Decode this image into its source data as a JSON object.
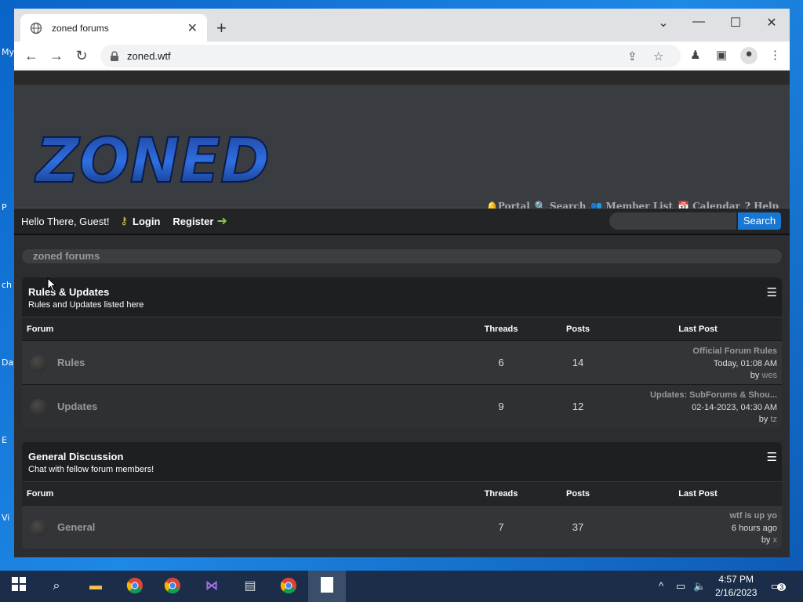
{
  "browser": {
    "tab_title": "zoned forums",
    "url": "zoned.wtf",
    "icons": [
      "globe-icon",
      "close-icon",
      "plus-icon",
      "back-icon",
      "forward-icon",
      "reload-icon",
      "lock-icon",
      "share-icon",
      "star-icon",
      "extension-icon",
      "sidepanel-icon",
      "profile-icon",
      "menu-icon"
    ]
  },
  "site": {
    "logo_text": "ZONED",
    "toplinks": {
      "portal": "Portal",
      "search": "Search",
      "member_list": "Member List",
      "calendar": "Calendar",
      "help": "Help"
    },
    "panel": {
      "welcome": "Hello There, Guest!",
      "login": "Login",
      "register": "Register",
      "search_button": "Search",
      "search_placeholder": ""
    },
    "breadcrumb": "zoned forums",
    "table_headers": {
      "forum": "Forum",
      "threads": "Threads",
      "posts": "Posts",
      "last_post": "Last Post"
    },
    "categories": [
      {
        "title": "Rules & Updates",
        "description": "Rules and Updates listed here",
        "forums": [
          {
            "name": "Rules",
            "threads": "6",
            "posts": "14",
            "last_title": "Official Forum Rules",
            "last_date": "Today, 01:08 AM",
            "by_label": "by",
            "last_user": "wes"
          },
          {
            "name": "Updates",
            "threads": "9",
            "posts": "12",
            "last_title": "Updates: SubForums & Shou...",
            "last_date": "02-14-2023, 04:30 AM",
            "by_label": "by",
            "last_user": "tz"
          }
        ]
      },
      {
        "title": "General Discussion",
        "description": "Chat with fellow forum members!",
        "forums": [
          {
            "name": "General",
            "threads": "7",
            "posts": "37",
            "last_title": "wtf is up yo",
            "last_date": "6 hours ago",
            "by_label": "by",
            "last_user": "x"
          }
        ]
      }
    ]
  },
  "taskbar": {
    "time": "4:57 PM",
    "date": "2/16/2023",
    "notification_count": "3"
  },
  "desktop": {
    "labels": [
      "My",
      "P",
      "ch",
      "Da",
      "E",
      "Vi"
    ]
  }
}
